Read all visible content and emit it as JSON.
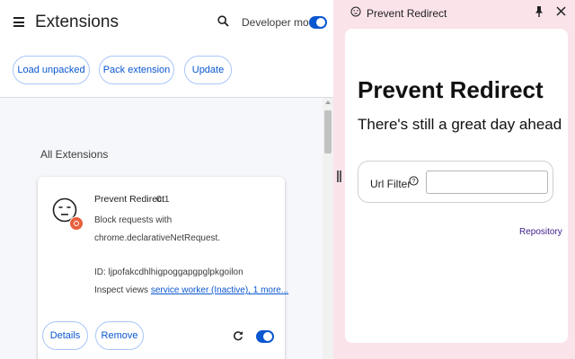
{
  "extensions_page": {
    "title": "Extensions",
    "developer_mode_label": "Developer mode",
    "developer_mode_enabled": true,
    "toolbar": {
      "load_unpacked": "Load unpacked",
      "pack_extension": "Pack extension",
      "update": "Update"
    },
    "section_title": "All Extensions",
    "extension": {
      "name": "Prevent Redirect",
      "version": "0.1",
      "description": "Block requests with chrome.declarativeNetRequest.",
      "id_text": "ID: ljpofakcdhlhigpoggapgpglpkgoilon",
      "inspect_prefix": "Inspect views ",
      "inspect_link": "service worker (Inactive)",
      "more_link": "1 more...",
      "details_label": "Details",
      "remove_label": "Remove",
      "enabled": true
    }
  },
  "side_panel": {
    "header_title": "Prevent Redirect",
    "app_title": "Prevent Redirect",
    "app_subtitle": "There's still a great day ahead",
    "url_filter_label": "Url Filter",
    "url_filter_value": "",
    "repository_link": "Repository"
  },
  "icons": {
    "menu": "menu-icon",
    "search": "search-icon",
    "extension_logo": "neutral-face-icon",
    "badge": "record-badge-icon",
    "reload": "reload-icon",
    "pin": "pin-icon",
    "close": "close-icon",
    "help": "help-circle-icon",
    "resize": "resize-handle-icon"
  },
  "colors": {
    "accent": "#0b57d0",
    "side_panel_bg": "#fbe3ea",
    "badge": "#e8603c",
    "repository_link": "#3a1e8c"
  }
}
